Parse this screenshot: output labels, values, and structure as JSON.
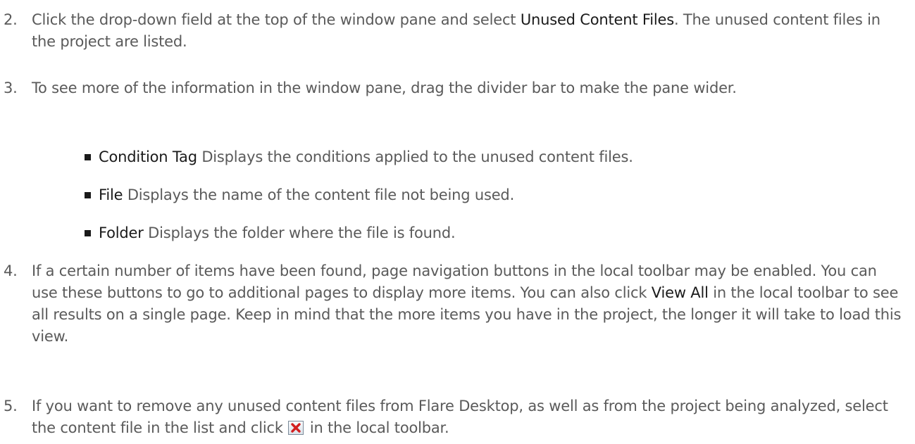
{
  "steps": [
    {
      "num": "2.",
      "pre": "Click the drop-down field at the top of the window pane and select ",
      "bold": "Unused Content Files",
      "post": ". The unused content files in the project are listed."
    },
    {
      "num": "3.",
      "text": "To see more of the information in the window pane, drag the divider bar to make the pane wider."
    },
    {
      "num": "4.",
      "pre": "If a certain number of items have been found, page navigation buttons in the local toolbar may be enabled. You can use these buttons to go to additional pages to display more items. You can also click ",
      "bold": "View All",
      "post": " in the local toolbar to see all results on a single page. Keep in mind that the more items you have in the project, the longer it will take to load this view."
    },
    {
      "num": "5.",
      "pre": "If you want to remove any unused content files from Flare Desktop, as well as from the project being analyzed, select the content file in the list and click ",
      "post": " in the local toolbar.",
      "icon": "delete-x-icon"
    }
  ],
  "bullets": [
    {
      "term": "Condition Tag",
      "desc": " Displays the conditions applied to the unused content files."
    },
    {
      "term": "File",
      "desc": " Displays the name of the content file not being used."
    },
    {
      "term": "Folder",
      "desc": " Displays the folder where the file is found."
    }
  ]
}
